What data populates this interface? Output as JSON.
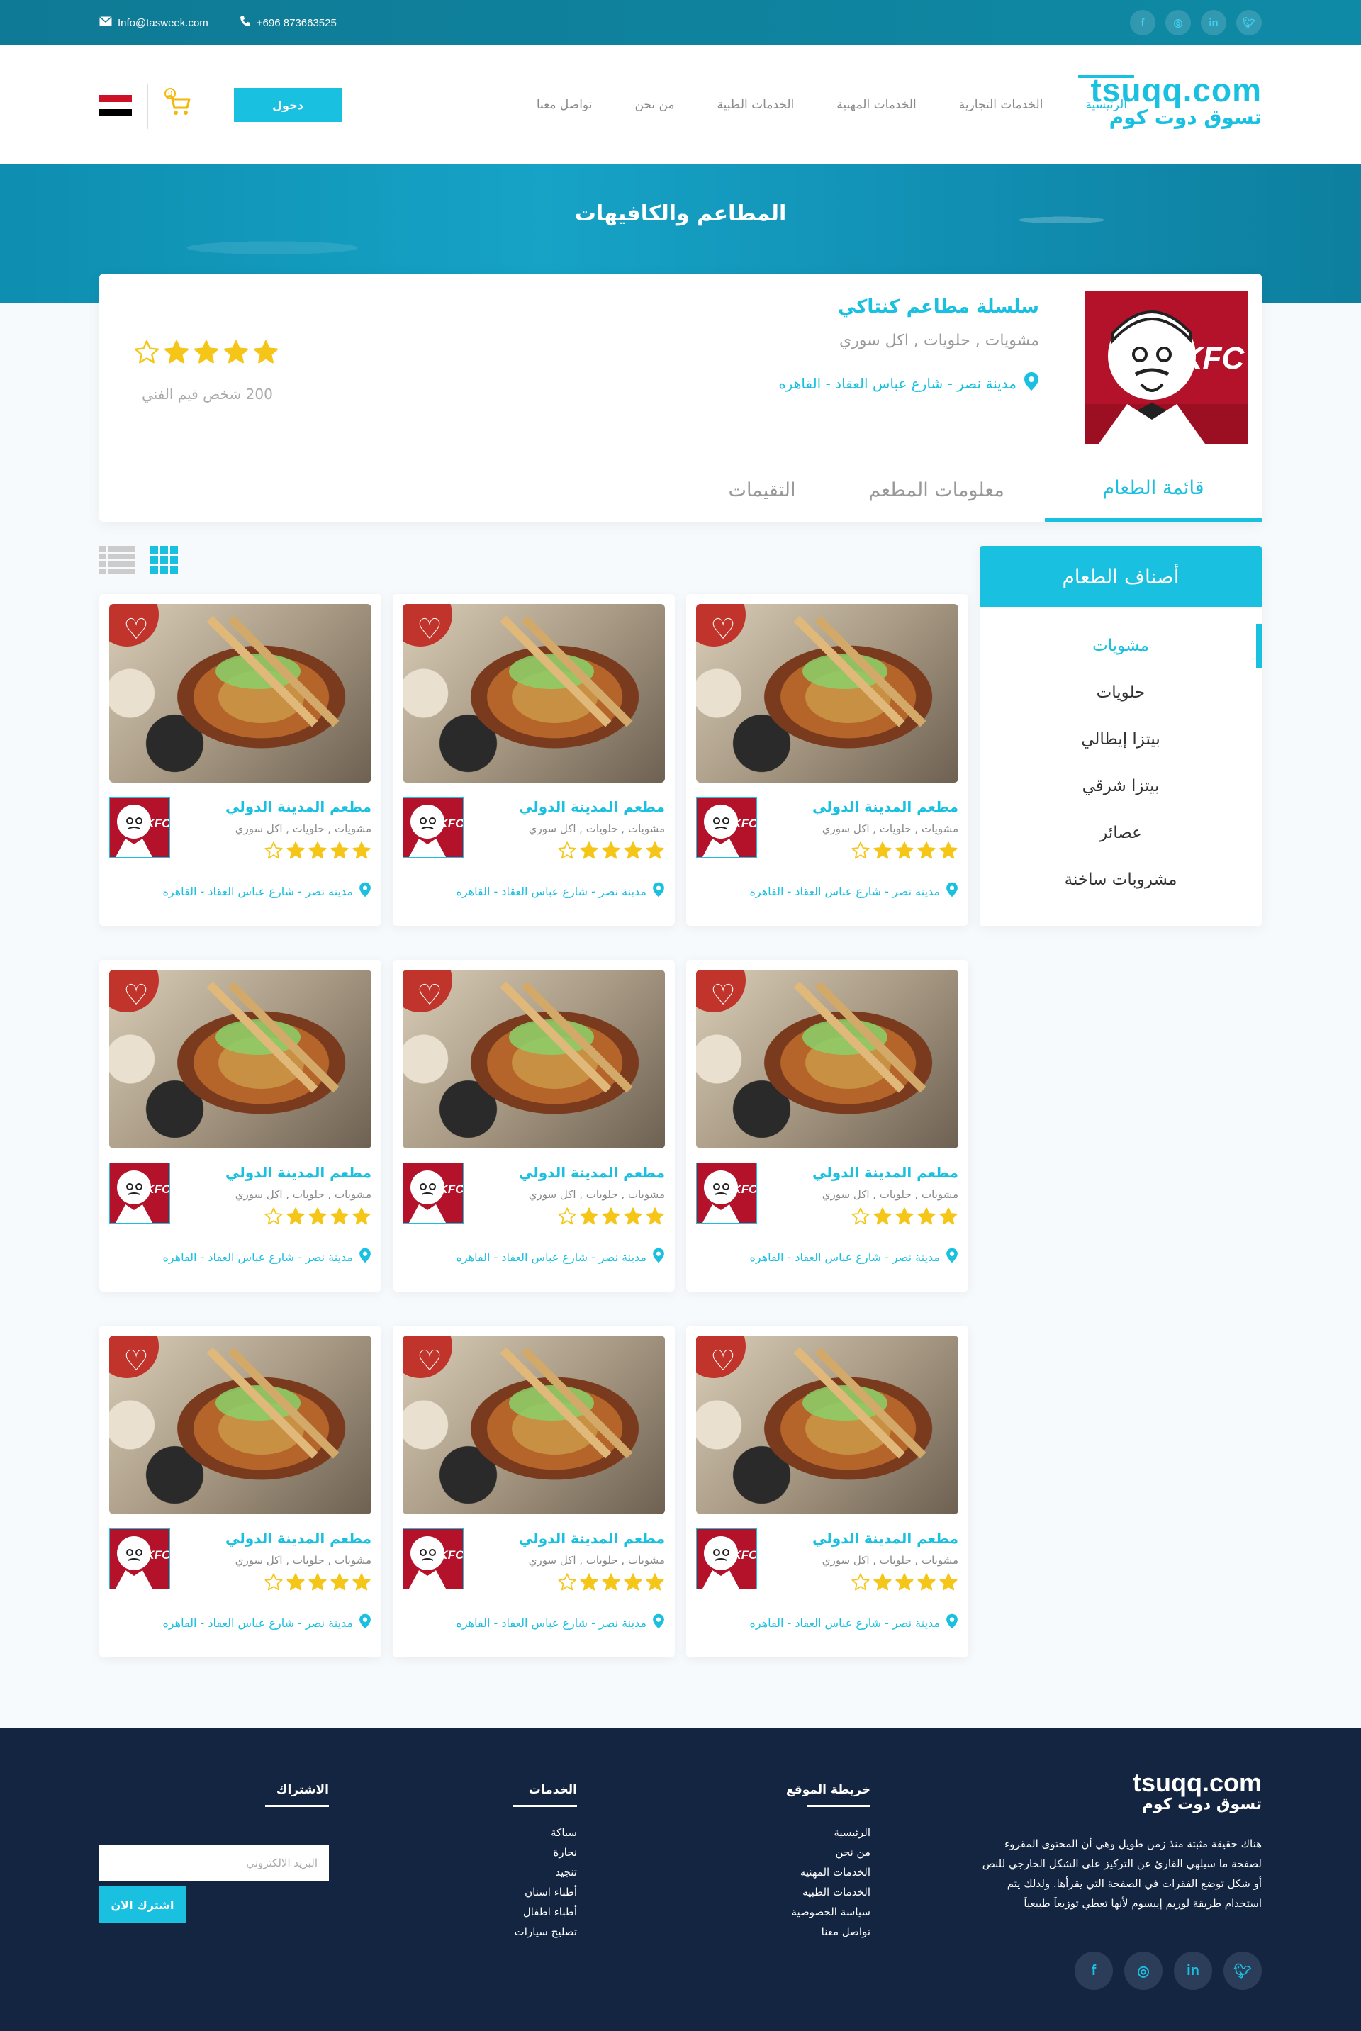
{
  "topbar": {
    "email": "Info@tasweek.com",
    "phone": "+696 873663525",
    "social": [
      "facebook-icon",
      "instagram-icon",
      "linkedin-icon",
      "twitter-icon"
    ]
  },
  "logo": {
    "en": "tsuqq.com",
    "ar": "تسوق دوت كوم"
  },
  "nav": {
    "items": [
      "الرئيسية",
      "الخدمات التجارية",
      "الخدمات المهنية",
      "الخدمات الطبية",
      "من نحن",
      "تواصل معنا"
    ],
    "login": "دخول",
    "cart_count": "0"
  },
  "banner": {
    "title": "المطاعم والكافيهات"
  },
  "restaurant": {
    "name": "سلسلة مطاعم كنتاكي",
    "tags": "مشويات , حلويات , اكل سوري",
    "location": "مدينة نصر - شارع عباس العقاد - القاهره",
    "rating": 4,
    "rating_count": "200 شخص قيم الفني",
    "logo_text": "KFC"
  },
  "tabs": [
    "قائمة الطعام",
    "معلومات المطعم",
    "التقيمات"
  ],
  "sidebar": {
    "title": "أصناف الطعام",
    "categories": [
      "مشويات",
      "حلويات",
      "بيتزا إيطالي",
      "بيتزا شرقي",
      "عصائر",
      "مشروبات ساخنة"
    ]
  },
  "cards": {
    "title": "مطعم المدينة الدولي",
    "tags": "مشويات , حلويات , اكل سوري",
    "location": "مدينة نصر - شارع عباس العقاد - القاهره",
    "rating": 4,
    "count": 9
  },
  "footer": {
    "about": "هناك حقيقة مثبتة منذ زمن طويل وهي أن المحتوى المقروء لصفحة ما سيلهي القارئ عن التركيز على الشكل الخارجي للنص أو شكل توضع الفقرات في الصفحة التي يقرأها. ولذلك يتم استخدام طريقة لوريم إيبسوم لأنها تعطي توزيعاَ طبيعياَ",
    "sitemap_title": "خريطة الموقع",
    "sitemap": [
      "الرئيسية",
      "من نحن",
      "الخدمات المهنيه",
      "الخدمات الطبيه",
      "سياسة الخصوصية",
      "تواصل معنا"
    ],
    "services_title": "الخدمات",
    "services": [
      "سباكة",
      "نجارة",
      "تنجيد",
      "أطباء اسنان",
      "أطباء اطفال",
      "تصليح سيارات"
    ],
    "subscribe_title": "الاشتراك",
    "email_placeholder": "البريد الالكتروني",
    "subscribe_btn": "اشترك الان"
  },
  "colors": {
    "accent": "#1ac0e0",
    "star": "#f5c518",
    "footer_bg": "#142541",
    "topbar": "#0f7a95"
  }
}
